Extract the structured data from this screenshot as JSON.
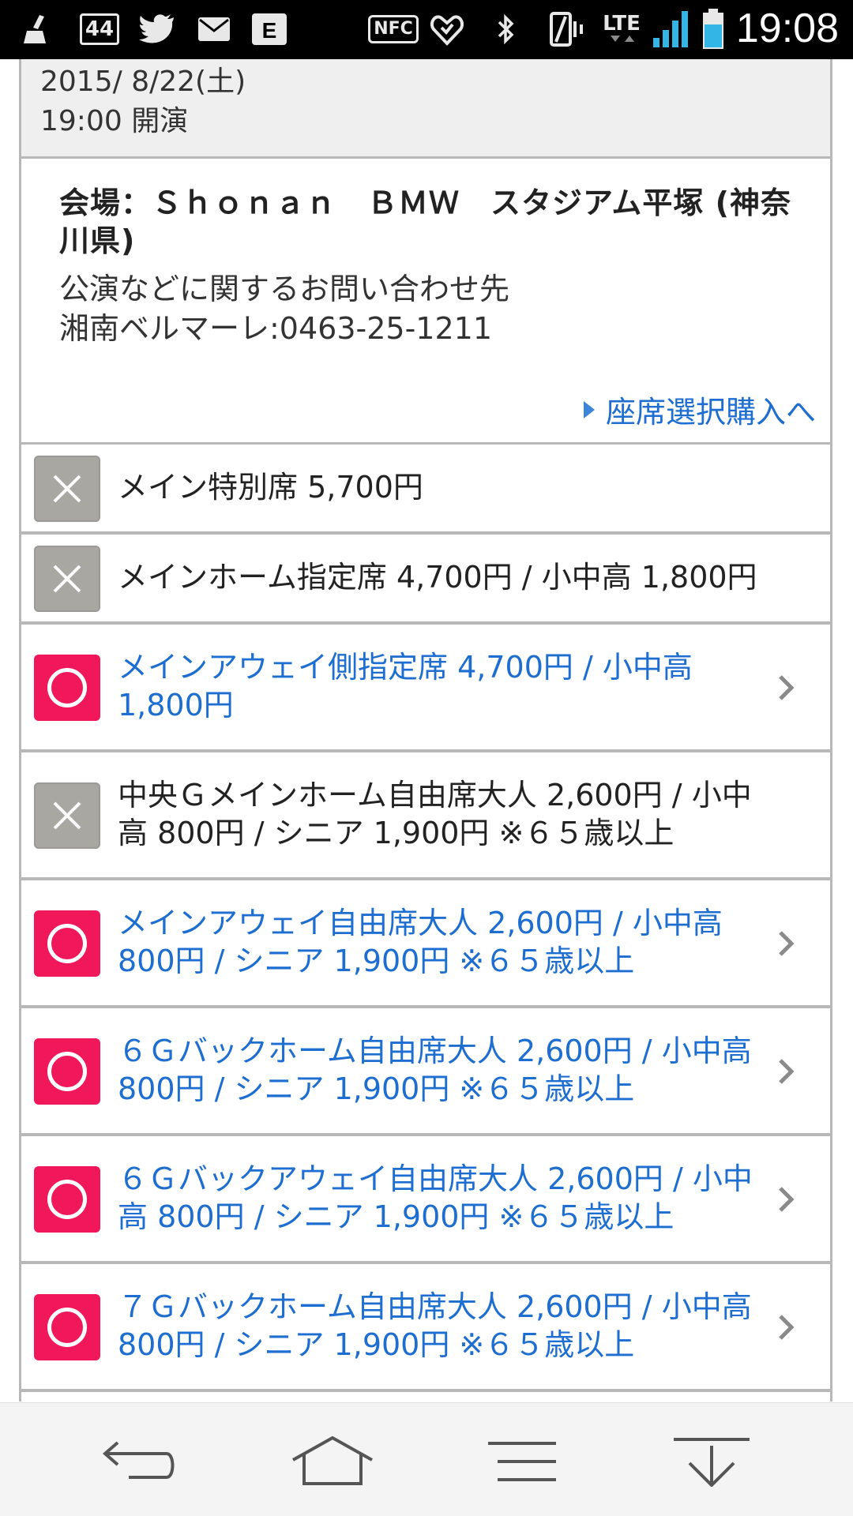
{
  "status_bar": {
    "time": "19:08",
    "badge_count": "44",
    "nfc_label": "NFC",
    "network_label": "LTE",
    "icons": [
      "broom-icon",
      "notification-count-icon",
      "twitter-icon",
      "mail-icon",
      "e-app-icon",
      "nfc-icon",
      "alarm-icon",
      "bluetooth-icon",
      "vibrate-icon",
      "lte-icon",
      "signal-icon",
      "battery-icon"
    ]
  },
  "event": {
    "date": "2015/ 8/22(土)",
    "time": "19:00 開演"
  },
  "venue": {
    "name": "会場：Ｓｈｏｎａｎ　ＢＭＷ　スタジアム平塚 (神奈川県)",
    "inquiry_label": "公演などに関するお問い合わせ先",
    "inquiry_contact": "湘南ベルマーレ:0463-25-1211",
    "purchase_link": "座席選択購入へ"
  },
  "seats": [
    {
      "label": "メイン特別席 5,700円",
      "available": false
    },
    {
      "label": "メインホーム指定席 4,700円 / 小中高 1,800円",
      "available": false
    },
    {
      "label": "メインアウェイ側指定席 4,700円 / 小中高 1,800円",
      "available": true
    },
    {
      "label": "中央Ｇメインホーム自由席大人 2,600円 / 小中高 800円 / シニア 1,900円 ※６５歳以上",
      "available": false
    },
    {
      "label": "メインアウェイ自由席大人 2,600円 / 小中高 800円 / シニア 1,900円 ※６５歳以上",
      "available": true
    },
    {
      "label": "６Ｇバックホーム自由席大人 2,600円 / 小中高 800円 / シニア 1,900円 ※６５歳以上",
      "available": true
    },
    {
      "label": "６Ｇバックアウェイ自由席大人 2,600円 / 小中高 800円 / シニア 1,900円 ※６５歳以上",
      "available": true
    },
    {
      "label": "７Ｇバックホーム自由席大人 2,600円 / 小中高 800円 / シニア 1,900円 ※６５歳以上",
      "available": true
    }
  ],
  "nav_bar": {
    "buttons": [
      "back-icon",
      "home-icon",
      "menu-icon",
      "download-icon"
    ]
  },
  "colors": {
    "available": "#f0185a",
    "soldout": "#a9a7a2",
    "link": "#1d6ed0"
  }
}
